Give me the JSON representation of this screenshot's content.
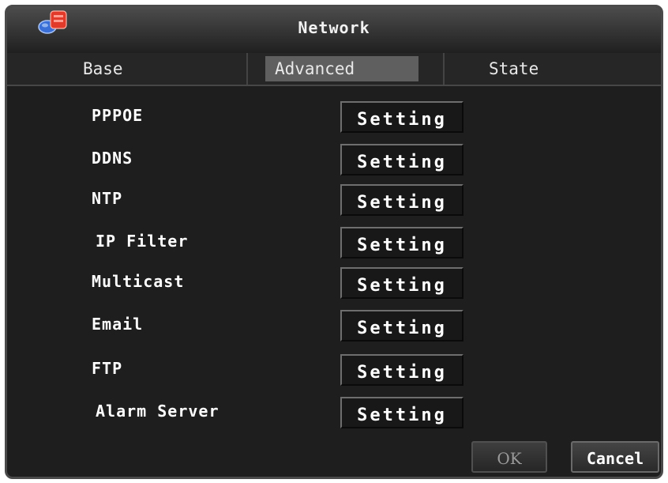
{
  "window": {
    "title": "Network"
  },
  "tabs": [
    {
      "label": "Base",
      "selected": false
    },
    {
      "label": "Advanced",
      "selected": true
    },
    {
      "label": "State",
      "selected": false
    }
  ],
  "settings": [
    {
      "label": "PPPOE",
      "button": "Setting"
    },
    {
      "label": "DDNS",
      "button": "Setting"
    },
    {
      "label": "NTP",
      "button": "Setting"
    },
    {
      "label": "IP Filter",
      "button": "Setting"
    },
    {
      "label": "Multicast",
      "button": "Setting"
    },
    {
      "label": "Email",
      "button": "Setting"
    },
    {
      "label": "FTP",
      "button": "Setting"
    },
    {
      "label": "Alarm Server",
      "button": "Setting"
    }
  ],
  "footer": {
    "ok_label": "OK",
    "ok_enabled": false,
    "cancel_label": "Cancel"
  },
  "icons": {
    "app": "network-app-icon"
  },
  "colors": {
    "background": "#1e1e1e",
    "tab_highlight": "#5f5f5f",
    "icon_red": "#e23a2a",
    "icon_blue": "#3a6fd8"
  }
}
